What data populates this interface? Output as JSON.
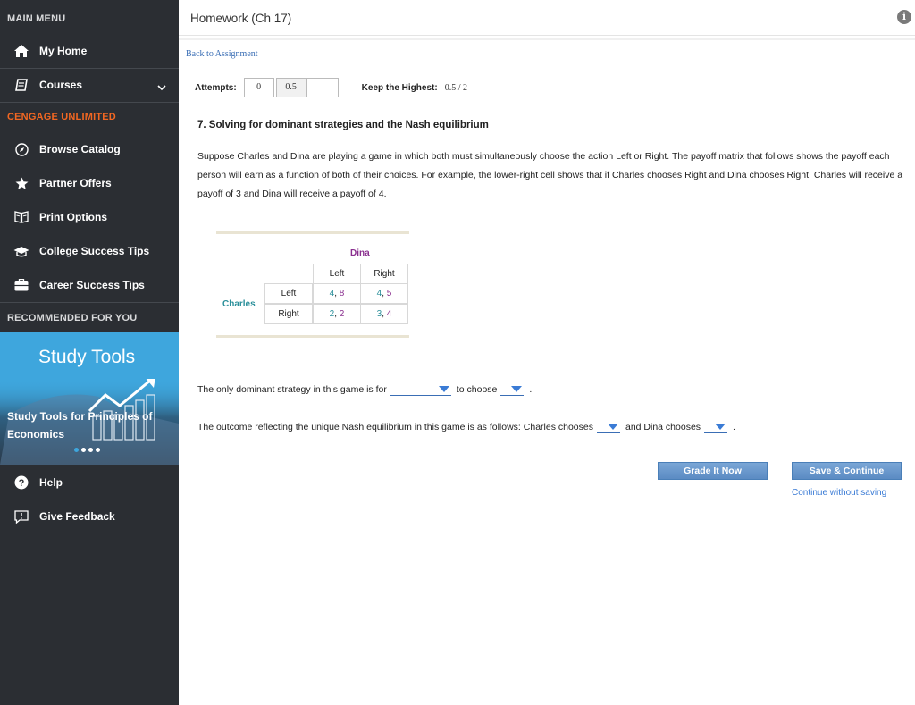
{
  "sidebar": {
    "main_menu": "MAIN MENU",
    "items_top": [
      {
        "label": "My Home",
        "icon": "home-icon"
      },
      {
        "label": "Courses",
        "icon": "book-icon"
      }
    ],
    "cengage_unlimited": "CENGAGE UNLIMITED",
    "items_mid": [
      {
        "label": "Browse Catalog",
        "icon": "compass-icon"
      },
      {
        "label": "Partner Offers",
        "icon": "star-icon"
      },
      {
        "label": "Print Options",
        "icon": "print-book-icon"
      },
      {
        "label": "College Success Tips",
        "icon": "graduation-cap-icon"
      },
      {
        "label": "Career Success Tips",
        "icon": "briefcase-icon"
      }
    ],
    "recommended": "RECOMMENDED FOR YOU",
    "study_tools": {
      "heading": "Study Tools",
      "caption": "Study Tools for Principles of Economics"
    },
    "items_bottom": [
      {
        "label": "Help",
        "icon": "help-icon"
      },
      {
        "label": "Give Feedback",
        "icon": "feedback-icon"
      }
    ]
  },
  "header": {
    "title": "Homework (Ch 17)"
  },
  "back_link": "Back to Assignment",
  "attempts": {
    "label": "Attempts:",
    "values": [
      "0",
      "0.5",
      ""
    ],
    "keep_label": "Keep the Highest:",
    "keep_value": "0.5 / 2"
  },
  "question": {
    "title": "7. Solving for dominant strategies and the Nash equilibrium",
    "body": "Suppose Charles and Dina are playing a game in which both must simultaneously choose the action Left or Right. The payoff matrix that follows shows the payoff each person will earn as a function of both of their choices. For example, the lower-right cell shows that if Charles chooses Right and Dina chooses Right, Charles will receive a payoff of 3 and Dina will receive a payoff of 4."
  },
  "matrix": {
    "col_player": "Dina",
    "row_player": "Charles",
    "col_headers": [
      "Left",
      "Right"
    ],
    "row_headers": [
      "Left",
      "Right"
    ],
    "cells": [
      [
        {
          "c": "4",
          "d": "8"
        },
        {
          "c": "4",
          "d": "5"
        }
      ],
      [
        {
          "c": "2",
          "d": "2"
        },
        {
          "c": "3",
          "d": "4"
        }
      ]
    ],
    "separator": ", "
  },
  "sentence1": {
    "part1": "The only dominant strategy in this game is for",
    "part2": "to choose",
    "end": "."
  },
  "sentence2": {
    "part1": "The outcome reflecting the unique Nash equilibrium in this game is as follows: Charles chooses",
    "part2": "and Dina chooses",
    "end": "."
  },
  "buttons": {
    "grade": "Grade It Now",
    "save": "Save & Continue",
    "continue_link": "Continue without saving"
  },
  "colors": {
    "sidebar": "#2b2e33",
    "accent": "#f26722",
    "study_tools": "#3ea6dd",
    "link": "#3a6eb5"
  }
}
